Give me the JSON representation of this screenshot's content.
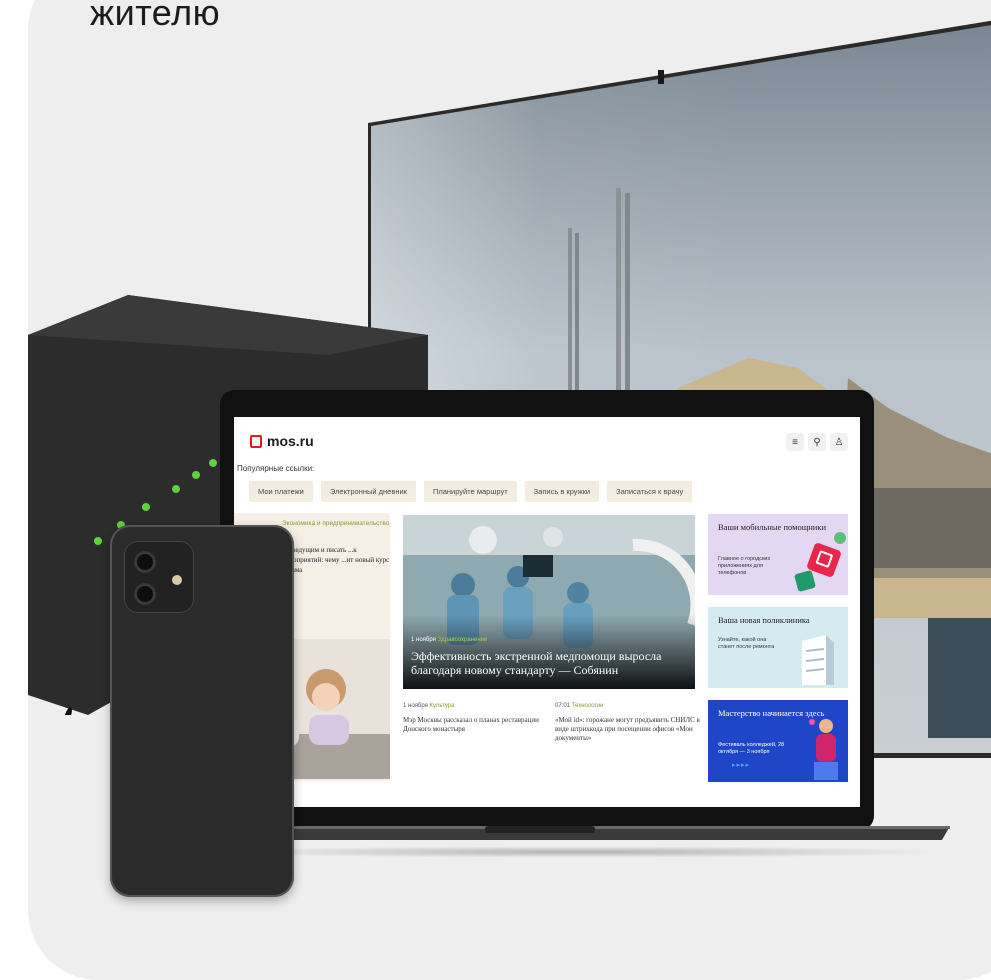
{
  "heading": "жителю",
  "site": {
    "logo_text": "mos.ru",
    "icons": [
      "menu-icon",
      "search-icon",
      "user-icon"
    ],
    "popular_label": "Популярные ссылки:",
    "chips": [
      "Мои платежи",
      "Электронный дневник",
      "Планируйте маршрут",
      "Запись в кружки",
      "Записаться к врачу"
    ],
    "left_card": {
      "category": "Экономика и предпринимательство",
      "text": "...ь ведущим и писать ...к мероприятий: чему ...ит новый курс «Мама"
    },
    "hero": {
      "date": "1 ноября",
      "tag": "Здравоохранение",
      "title": "Эффективность экстренной медпомощи выросла благодаря новому стандарту — Собянин"
    },
    "news": [
      {
        "date": "1 ноября",
        "tag": "Культура",
        "title": "Мэр Москвы рассказал о планах реставрации Донского монастыря"
      },
      {
        "date": "07:01",
        "tag": "Технологии",
        "title": "«Мой id»: горожане могут предъявить СНИЛС в виде штрихкода при посещении офисов «Мои документы»"
      }
    ],
    "promos": [
      {
        "title": "Ваши мобильные помощники",
        "subtitle": "Главное о городских приложениях для телефонов",
        "color": "#e3d7f3"
      },
      {
        "title": "Ваша новая поликлиника",
        "subtitle": "Узнайте, какой она станет после ремонта",
        "color": "#d4ecf1"
      },
      {
        "title": "Мастерство начинается здесь",
        "subtitle": "Фестиваль колледжей, 28 октября — 3 ноября",
        "arrows": "▸▸▸▸",
        "color": "#1f46c7"
      }
    ]
  },
  "colors": {
    "brand_red": "#d9211c",
    "chip_bg": "#f2ece1",
    "tag_green": "#8a9a2a",
    "card_bg": "#eeeeef"
  }
}
